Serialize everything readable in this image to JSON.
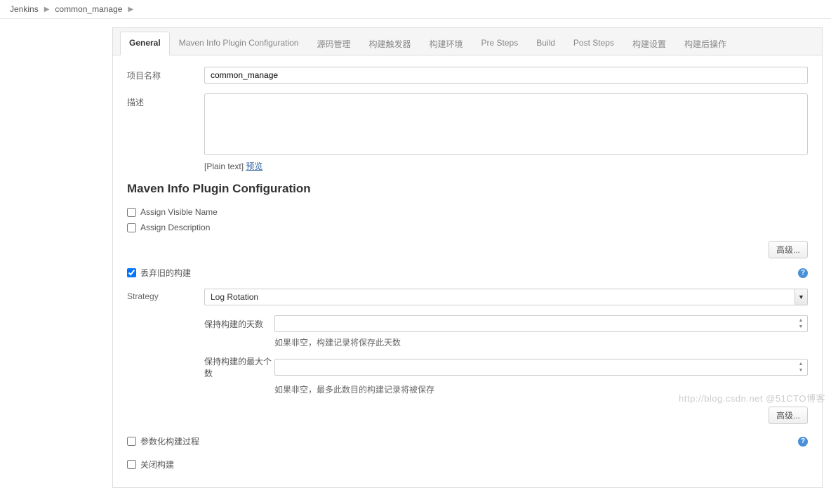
{
  "breadcrumbs": {
    "items": [
      "Jenkins",
      "common_manage"
    ]
  },
  "tabs": [
    {
      "label": "General",
      "active": true
    },
    {
      "label": "Maven Info Plugin Configuration"
    },
    {
      "label": "源码管理"
    },
    {
      "label": "构建触发器"
    },
    {
      "label": "构建环境"
    },
    {
      "label": "Pre Steps"
    },
    {
      "label": "Build"
    },
    {
      "label": "Post Steps"
    },
    {
      "label": "构建设置"
    },
    {
      "label": "构建后操作"
    }
  ],
  "general": {
    "projectNameLabel": "项目名称",
    "projectNameValue": "common_manage",
    "descLabel": "描述",
    "descValue": "",
    "plainText": "[Plain text]",
    "previewLink": "预览"
  },
  "mavenInfo": {
    "title": "Maven Info Plugin Configuration",
    "assignVisibleName": "Assign Visible Name",
    "assignDescription": "Assign Description",
    "advancedLabel": "高级..."
  },
  "discard": {
    "label": "丢弃旧的构建",
    "checked": true,
    "strategyLabel": "Strategy",
    "strategyValue": "Log Rotation",
    "keepDaysLabel": "保持构建的天数",
    "keepDaysHelp": "如果非空，构建记录将保存此天数",
    "keepMaxLabel": "保持构建的最大个数",
    "keepMaxHelp": "如果非空，最多此数目的构建记录将被保存",
    "advancedLabel": "高级..."
  },
  "paramBuild": {
    "label": "参数化构建过程"
  },
  "closeBuild": {
    "label": "关闭构建"
  },
  "watermark": "http://blog.csdn.net @51CTO博客"
}
